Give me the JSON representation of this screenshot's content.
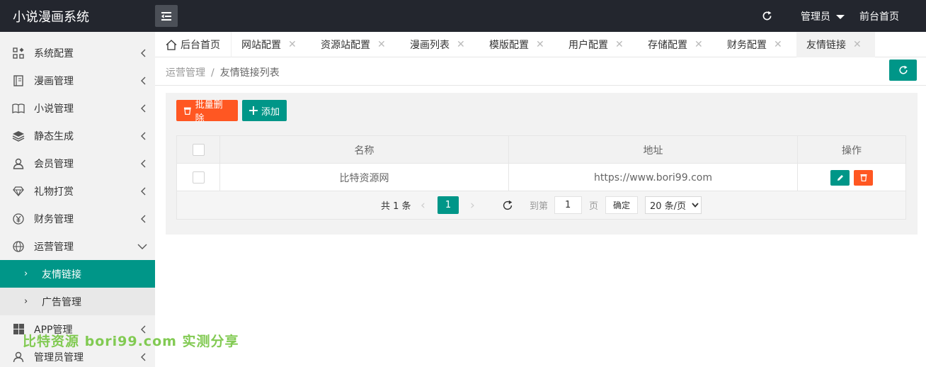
{
  "app": {
    "title": "小说漫画系统"
  },
  "header": {
    "admin_label": "管理员",
    "front_label": "前台首页"
  },
  "sidebar": {
    "items": [
      {
        "label": "系统配置",
        "icon": "grid-icon"
      },
      {
        "label": "漫画管理",
        "icon": "book-icon"
      },
      {
        "label": "小说管理",
        "icon": "open-book-icon"
      },
      {
        "label": "静态生成",
        "icon": "layers-icon"
      },
      {
        "label": "会员管理",
        "icon": "user-icon"
      },
      {
        "label": "礼物打赏",
        "icon": "diamond-icon"
      },
      {
        "label": "财务管理",
        "icon": "yen-icon"
      },
      {
        "label": "运营管理",
        "icon": "globe-icon"
      },
      {
        "label": "APP管理",
        "icon": "windows-icon"
      },
      {
        "label": "管理员管理",
        "icon": "user-icon"
      }
    ],
    "sub_items": [
      {
        "label": "友情链接"
      },
      {
        "label": "广告管理"
      }
    ]
  },
  "tabs": [
    {
      "label": "后台首页"
    },
    {
      "label": "网站配置"
    },
    {
      "label": "资源站配置"
    },
    {
      "label": "漫画列表"
    },
    {
      "label": "模版配置"
    },
    {
      "label": "用户配置"
    },
    {
      "label": "存储配置"
    },
    {
      "label": "财务配置"
    },
    {
      "label": "友情链接"
    }
  ],
  "breadcrumb": {
    "parent": "运营管理",
    "separator": "/",
    "current": "友情链接列表"
  },
  "toolbar": {
    "batch_delete_label": "批量删除",
    "add_label": "添加"
  },
  "table": {
    "headers": {
      "name": "名称",
      "url": "地址",
      "action": "操作"
    },
    "rows": [
      {
        "name": "比特资源网",
        "url": "https://www.bori99.com"
      }
    ]
  },
  "pager": {
    "total_label": "共 1 条",
    "current_page": "1",
    "goto_label": "到第",
    "goto_value": "1",
    "page_unit": "页",
    "confirm_label": "确定",
    "page_size": "20 条/页"
  },
  "watermark": {
    "text": "比特资源 bori99.com 实测分享"
  },
  "colors": {
    "accent": "#009688",
    "danger": "#ff5722",
    "header_bg": "#23262e",
    "sidebar_bg": "#f2f2f2"
  }
}
